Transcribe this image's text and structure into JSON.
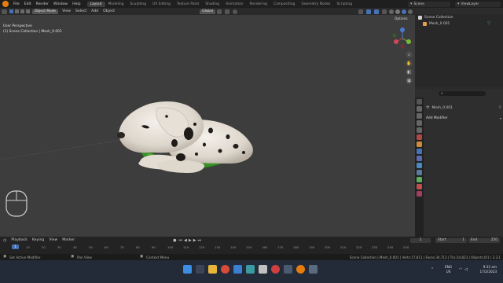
{
  "topbar": {
    "menus": [
      "File",
      "Edit",
      "Render",
      "Window",
      "Help"
    ],
    "workspace_tabs": [
      "Layout",
      "Modeling",
      "Sculpting",
      "UV Editing",
      "Texture Paint",
      "Shading",
      "Animation",
      "Rendering",
      "Compositing",
      "Geometry Nodes",
      "Scripting"
    ],
    "active_tab": "Layout",
    "scene": "Scene",
    "view_layer": "ViewLayer"
  },
  "viewport_header": {
    "mode": "Object Mode",
    "menus": [
      "View",
      "Select",
      "Add",
      "Object"
    ],
    "orientation": "Global",
    "options": "Options"
  },
  "viewport": {
    "perspective": "User Perspective",
    "collection_info": "(1) Scene Collection | Mesh_0.001"
  },
  "outliner": {
    "root": "Scene Collection",
    "item": "Mesh_0.001"
  },
  "properties": {
    "object_name": "Mesh_0.001",
    "add_modifier": "Add Modifier"
  },
  "timeline": {
    "menus": [
      "Playback",
      "Keying",
      "View",
      "Marker"
    ],
    "current_frame": "1",
    "start_label": "Start",
    "start": "1",
    "end_label": "End",
    "end": "250",
    "ticks": [
      "1",
      "10",
      "20",
      "30",
      "40",
      "50",
      "60",
      "70",
      "80",
      "90",
      "100",
      "110",
      "120",
      "130",
      "140",
      "150",
      "160",
      "170",
      "180",
      "190",
      "200",
      "210",
      "220",
      "230",
      "240",
      "250"
    ]
  },
  "statusbar": {
    "left": "Set Active Modifier",
    "mid1": "Pan View",
    "mid2": "Context Menu",
    "right": "Scene Collection | Mesh_0.001 | Verts:17,811 | Faces:34,713 | Tris:34,823 | Objects:0/1 | 3.3.1"
  },
  "taskbar": {
    "lang1": "ENG",
    "lang2": "US",
    "time": "9:32 am",
    "date": "17/2/2023"
  },
  "colors": {
    "accent": "#4772b3",
    "viewport_bg": "#3d3d3d",
    "dog_body": "#e9e4dd",
    "ring": "#3c8f2a"
  }
}
